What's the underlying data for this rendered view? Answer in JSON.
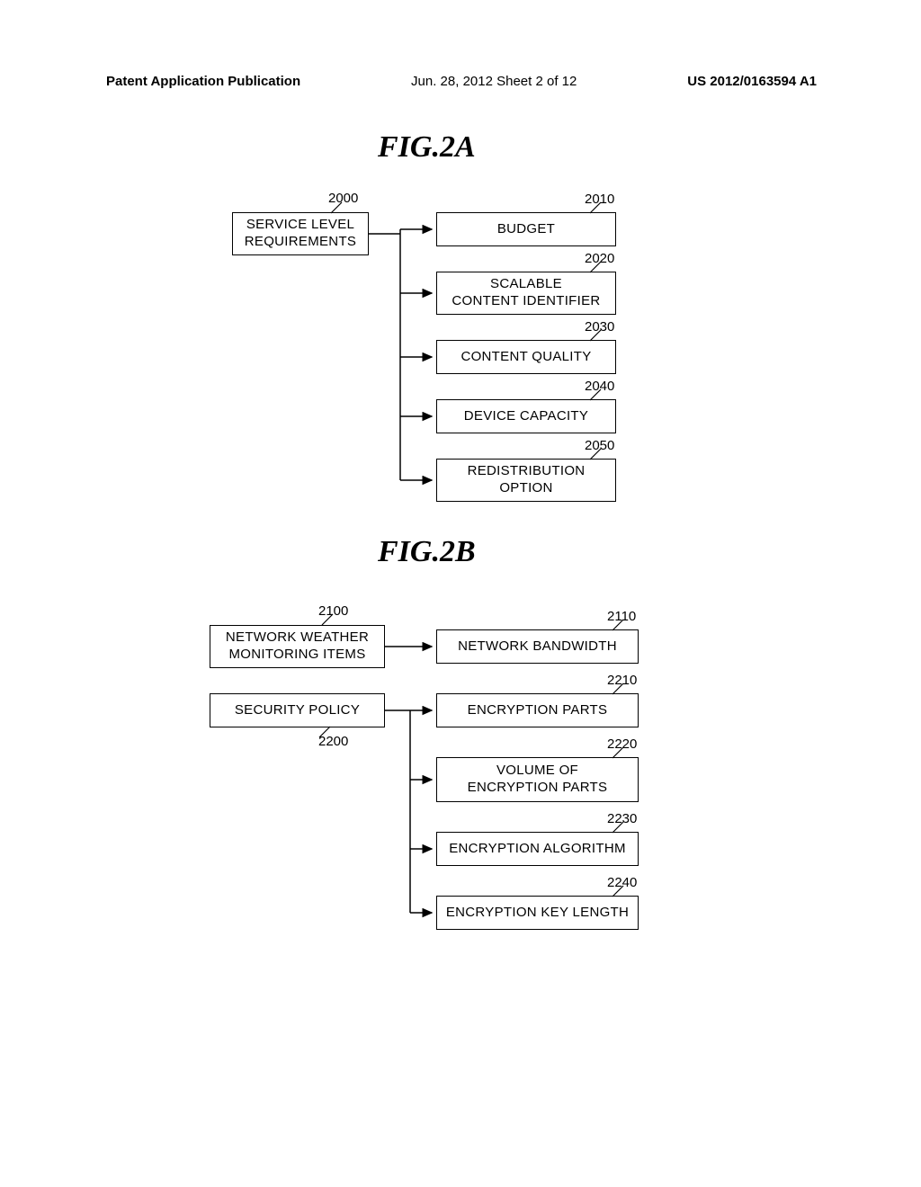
{
  "header": {
    "left": "Patent Application Publication",
    "middle": "Jun. 28, 2012  Sheet 2 of 12",
    "right": "US 2012/0163594 A1"
  },
  "figA": {
    "title": "FIG.2A",
    "root": {
      "label": "SERVICE LEVEL\nREQUIREMENTS",
      "ref": "2000"
    },
    "children": [
      {
        "label": "BUDGET",
        "ref": "2010"
      },
      {
        "label": "SCALABLE\nCONTENT IDENTIFIER",
        "ref": "2020"
      },
      {
        "label": "CONTENT QUALITY",
        "ref": "2030"
      },
      {
        "label": "DEVICE CAPACITY",
        "ref": "2040"
      },
      {
        "label": "REDISTRIBUTION\nOPTION",
        "ref": "2050"
      }
    ]
  },
  "figB": {
    "title": "FIG.2B",
    "roots": [
      {
        "label": "NETWORK WEATHER\nMONITORING ITEMS",
        "ref": "2100"
      },
      {
        "label": "SECURITY POLICY",
        "ref": "2200"
      }
    ],
    "children": [
      {
        "label": "NETWORK BANDWIDTH",
        "ref": "2110"
      },
      {
        "label": "ENCRYPTION PARTS",
        "ref": "2210"
      },
      {
        "label": "VOLUME OF\nENCRYPTION PARTS",
        "ref": "2220"
      },
      {
        "label": "ENCRYPTION ALGORITHM",
        "ref": "2230"
      },
      {
        "label": "ENCRYPTION KEY LENGTH",
        "ref": "2240"
      }
    ]
  }
}
